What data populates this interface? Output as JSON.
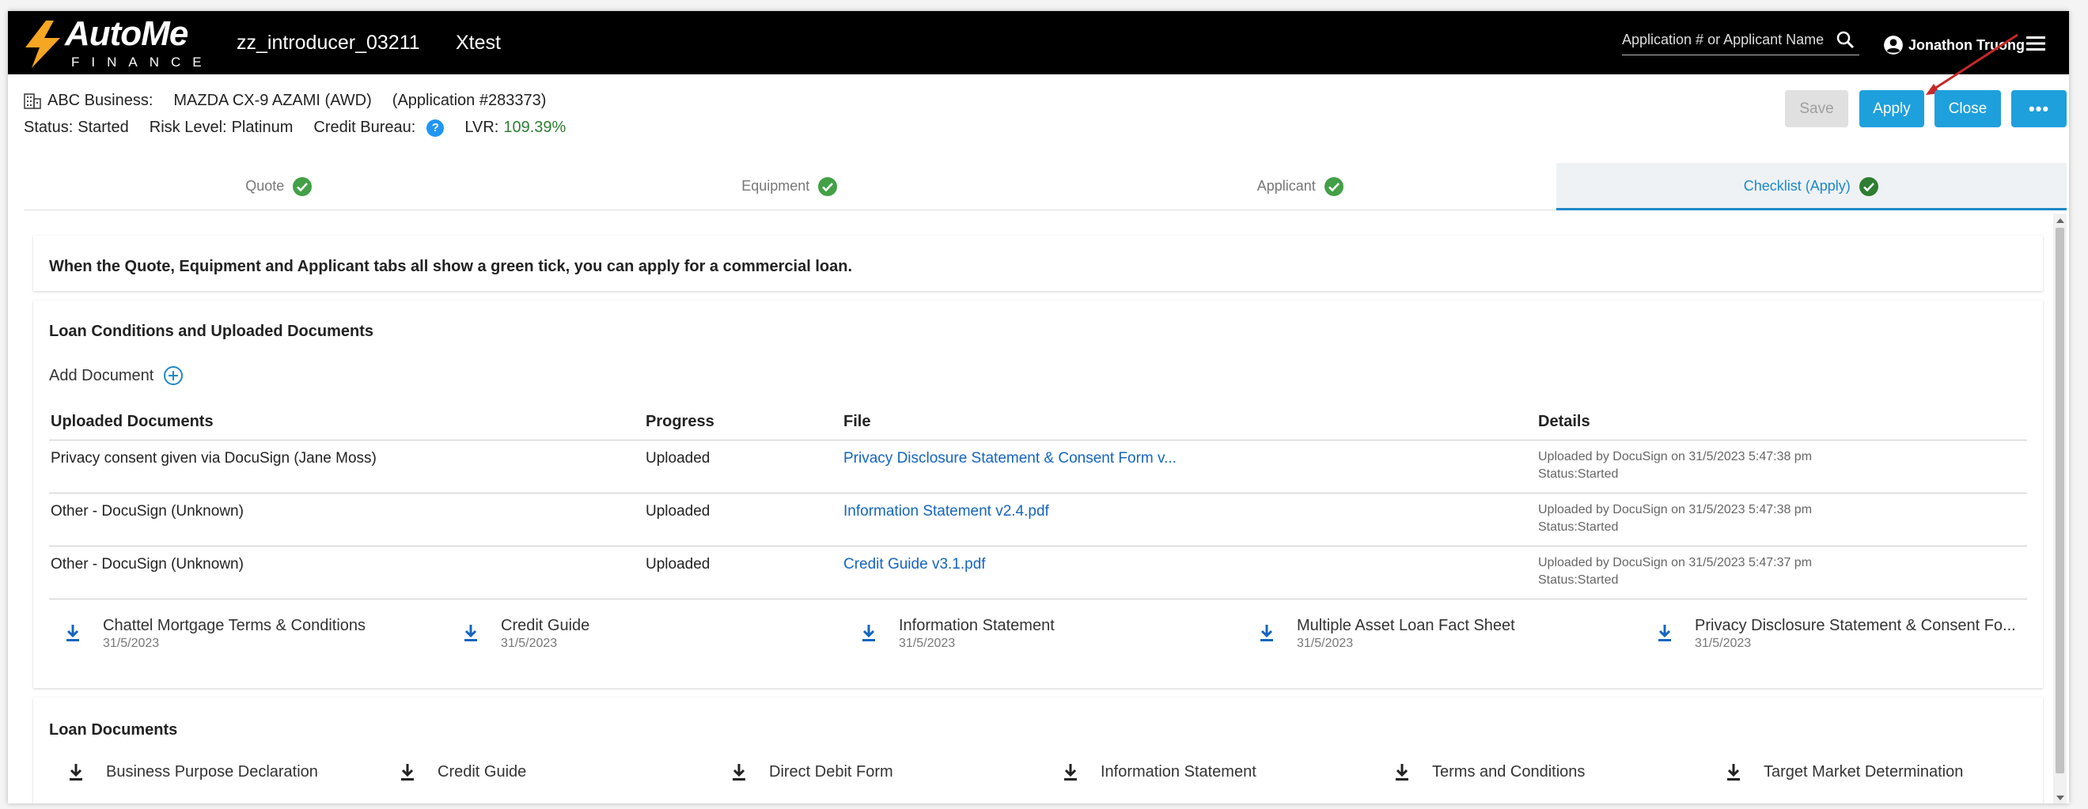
{
  "header": {
    "logo": {
      "word": "AutoMe",
      "sub": "FINANCE"
    },
    "user_code": "zz_introducer_03211",
    "company": "Xtest",
    "search": {
      "placeholder": "Application # or Applicant Name",
      "value": ""
    },
    "user_name": "Jonathon Truong"
  },
  "application": {
    "business_label": "ABC Business:",
    "vehicle": "MAZDA CX-9 AZAMI (AWD)",
    "app_number": "(Application #283373)",
    "status_label": "Status:",
    "status": "Started",
    "risk_label": "Risk Level:",
    "risk": "Platinum",
    "bureau_label": "Credit Bureau:",
    "bureau_icon": "?",
    "lvr_label": "LVR:",
    "lvr": "109.39%"
  },
  "actions": {
    "save": "Save",
    "apply": "Apply",
    "close": "Close",
    "more": "•••"
  },
  "tabs": [
    {
      "label": "Quote",
      "complete": true
    },
    {
      "label": "Equipment",
      "complete": true
    },
    {
      "label": "Applicant",
      "complete": true
    },
    {
      "label": "Checklist (Apply)",
      "complete": true,
      "active": true
    }
  ],
  "intro": "When the Quote, Equipment and Applicant tabs all show a green tick, you can apply for a commercial loan.",
  "conditions": {
    "title": "Loan Conditions and Uploaded Documents",
    "add_document": "Add Document",
    "columns": [
      "Uploaded Documents",
      "Progress",
      "File",
      "Details"
    ],
    "rows": [
      {
        "document": "Privacy consent given via DocuSign (Jane Moss)",
        "progress": "Uploaded",
        "file": "Privacy Disclosure Statement & Consent Form v...",
        "uploaded": "Uploaded by DocuSign on 31/5/2023 5:47:38 pm",
        "status": "Status:Started"
      },
      {
        "document": "Other - DocuSign (Unknown)",
        "progress": "Uploaded",
        "file": "Information Statement v2.4.pdf",
        "uploaded": "Uploaded by DocuSign on 31/5/2023 5:47:38 pm",
        "status": "Status:Started"
      },
      {
        "document": "Other - DocuSign (Unknown)",
        "progress": "Uploaded",
        "file": "Credit Guide v3.1.pdf",
        "uploaded": "Uploaded by DocuSign on 31/5/2023 5:47:37 pm",
        "status": "Status:Started"
      }
    ],
    "downloads": [
      {
        "name": "Chattel Mortgage Terms & Conditions",
        "date": "31/5/2023"
      },
      {
        "name": "Credit Guide",
        "date": "31/5/2023"
      },
      {
        "name": "Information Statement",
        "date": "31/5/2023"
      },
      {
        "name": "Multiple Asset Loan Fact Sheet",
        "date": "31/5/2023"
      },
      {
        "name": "Privacy Disclosure Statement & Consent Fo...",
        "date": "31/5/2023"
      }
    ]
  },
  "loan_documents": {
    "title": "Loan Documents",
    "items": [
      "Business Purpose Declaration",
      "Credit Guide",
      "Direct Debit Form",
      "Information Statement",
      "Terms and Conditions",
      "Target Market Determination"
    ]
  },
  "colors": {
    "accent": "#1ea0dc",
    "link": "#1565c0",
    "success": "#2e7d32",
    "tick": "#43a047"
  }
}
